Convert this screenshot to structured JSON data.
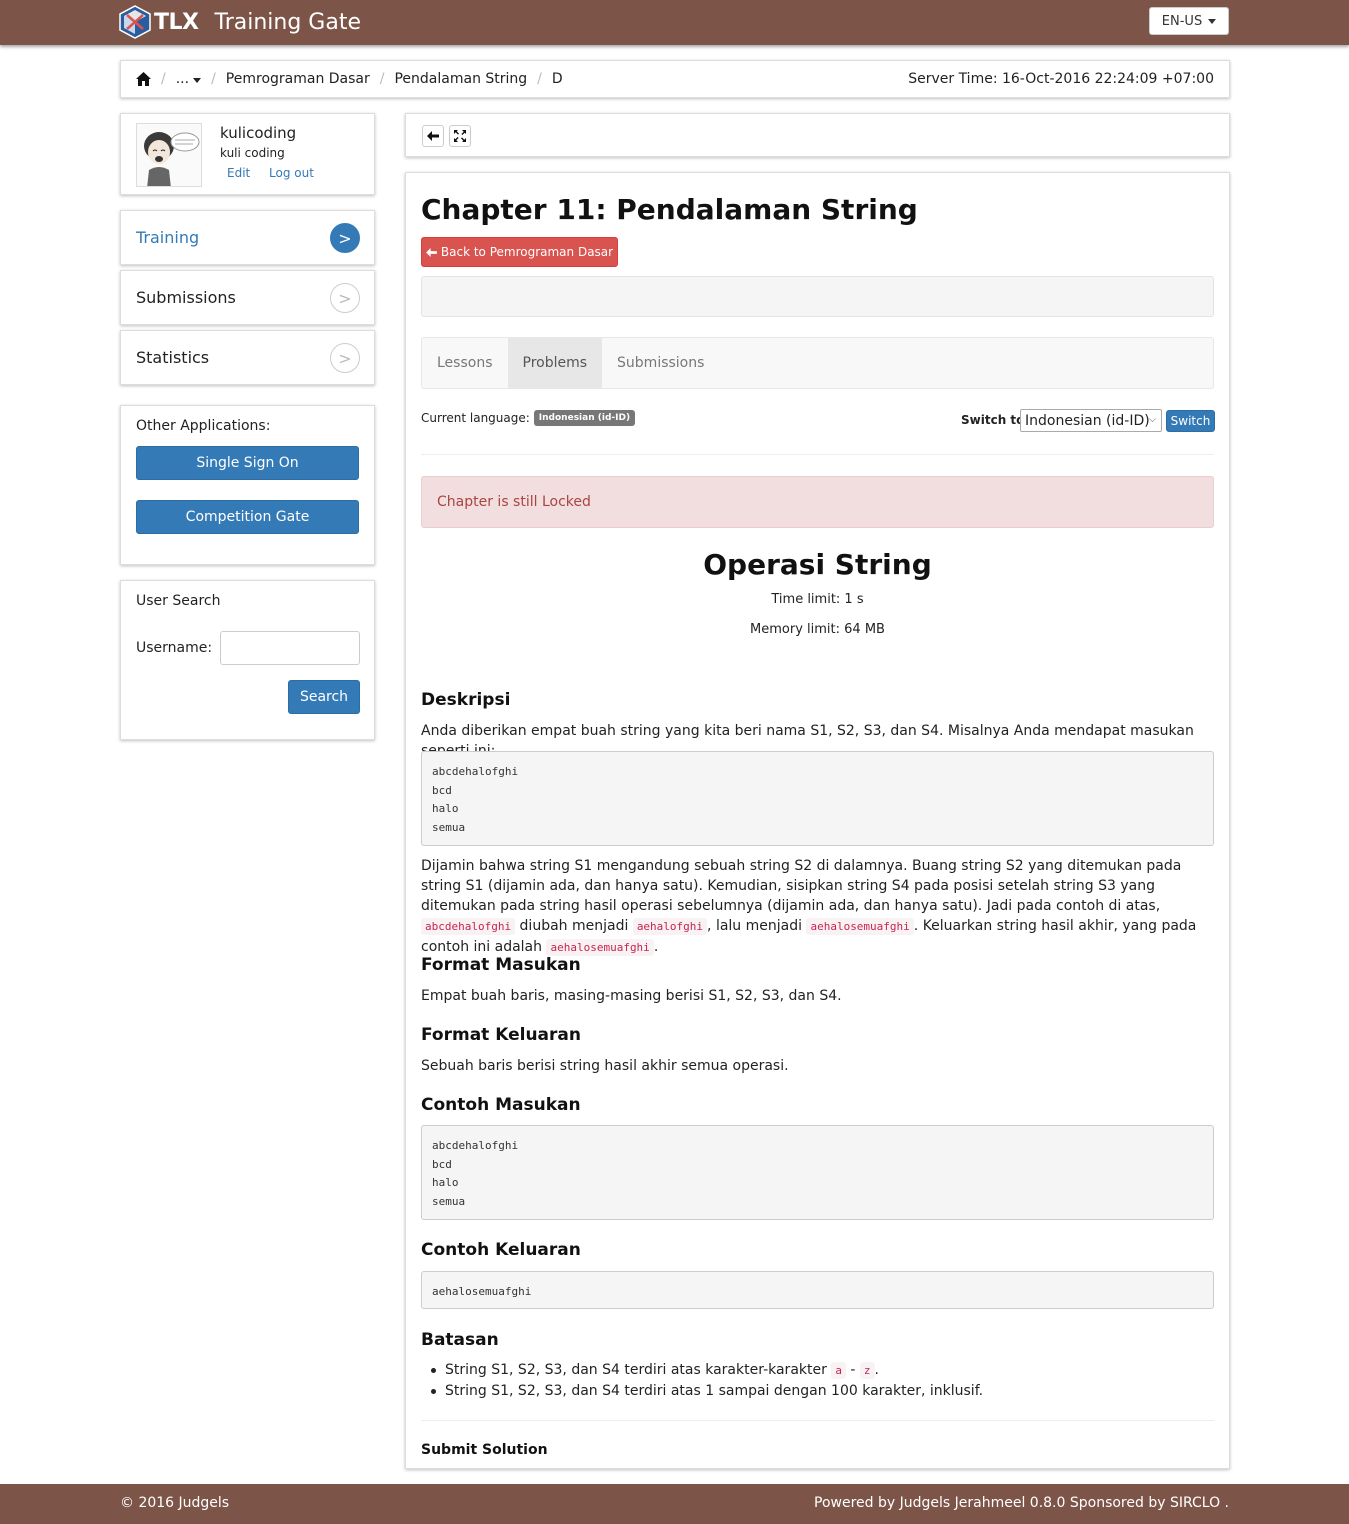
{
  "header": {
    "logo_text": "TLX",
    "app_name": "Training Gate",
    "language": "EN-US"
  },
  "breadcrumb": {
    "ellipsis": "...",
    "items": [
      "Pemrograman Dasar",
      "Pendalaman String",
      "D"
    ],
    "server_time": "Server Time: 16-Oct-2016 22:24:09 +07:00"
  },
  "user": {
    "username": "kulicoding",
    "full_name": "kuli coding",
    "edit": "Edit",
    "logout": "Log out"
  },
  "sidebar": {
    "menu": [
      {
        "label": "Training",
        "arrow": ">"
      },
      {
        "label": "Submissions",
        "arrow": ">"
      },
      {
        "label": "Statistics",
        "arrow": ">"
      }
    ],
    "other_apps_title": "Other Applications:",
    "sso_button": "Single Sign On",
    "competition_button": "Competition Gate",
    "user_search_title": "User Search",
    "username_label": "Username:",
    "search_button": "Search"
  },
  "main": {
    "chapter_title": "Chapter 11: Pendalaman String",
    "back_button": "Back to Pemrograman Dasar",
    "tabs": [
      "Lessons",
      "Problems",
      "Submissions"
    ],
    "current_language_label": "Current language:",
    "current_language": "Indonesian (id-ID)",
    "switch_to_label": "Switch to",
    "switch_select_value": "Indonesian (id-ID)",
    "switch_button": "Switch",
    "alert": "Chapter is still Locked"
  },
  "problem": {
    "title": "Operasi String",
    "time_limit": "Time limit: 1 s",
    "memory_limit": "Memory limit: 64 MB",
    "deskripsi_heading": "Deskripsi",
    "deskripsi_intro": "Anda diberikan empat buah string yang kita beri nama S1, S2, S3, dan S4. Misalnya Anda mendapat masukan seperti ini:",
    "deskripsi_example": "abcdehalofghi\nbcd\nhalo\nsemua",
    "deskripsi_p2_a": "Dijamin bahwa string S1 mengandung sebuah string S2 di dalamnya. Buang string S2 yang ditemukan pada string S1 (dijamin ada, dan hanya satu). Kemudian, sisipkan string S4 pada posisi setelah string S3 yang ditemukan pada string hasil operasi sebelumnya (dijamin ada, dan hanya satu). Jadi pada contoh di atas,",
    "code1": "abcdehalofghi",
    "deskripsi_p2_b": "diubah menjadi",
    "code2": "aehalofghi",
    "deskripsi_p2_c": ", lalu menjadi",
    "code3": "aehalosemuafghi",
    "deskripsi_p2_d": ". Keluarkan string hasil akhir, yang pada contoh ini adalah",
    "code4": "aehalosemuafghi",
    "deskripsi_p2_e": ".",
    "format_masukan_heading": "Format Masukan",
    "format_masukan": "Empat buah baris, masing-masing berisi S1, S2, S3, dan S4.",
    "format_keluaran_heading": "Format Keluaran",
    "format_keluaran": "Sebuah baris berisi string hasil akhir semua operasi.",
    "contoh_masukan_heading": "Contoh Masukan",
    "contoh_masukan": "abcdehalofghi\nbcd\nhalo\nsemua",
    "contoh_keluaran_heading": "Contoh Keluaran",
    "contoh_keluaran": "aehalosemuafghi",
    "batasan_heading": "Batasan",
    "batasan1_a": "String S1, S2, S3, dan S4 terdiri atas karakter-karakter",
    "batasan1_code_a": "a",
    "batasan1_dash": "-",
    "batasan1_code_z": "z",
    "batasan1_end": ".",
    "batasan2": "String S1, S2, S3, dan S4 terdiri atas 1 sampai dengan 100 karakter, inklusif.",
    "submit_heading": "Submit Solution"
  },
  "footer": {
    "left": "© 2016 Judgels",
    "right": "Powered by Judgels Jerahmeel 0.8.0 Sponsored by SIRCLO ."
  },
  "colors": {
    "brand": "#7d5548",
    "primary": "#337ab7",
    "danger": "#d9534f"
  }
}
